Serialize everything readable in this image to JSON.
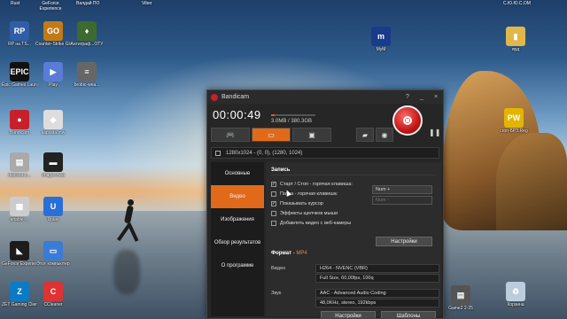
{
  "top_labels": [
    "Rust",
    "GeForce Experience",
    "Viber",
    "Валдай ПО",
    "С.Ю.Ю.С.ОМ"
  ],
  "desktop_left": [
    {
      "label": "RP на TS...",
      "color": "#2f5ea3",
      "glyph": "RP"
    },
    {
      "label": "Counter-Strike Global Offe...",
      "color": "#c27a18",
      "glyph": "GO"
    },
    {
      "label": "Антиграф...ОТУ",
      "color": "#3d6a2e",
      "glyph": "♦"
    },
    {
      "label": "Epic Games Launcher",
      "color": "#111",
      "glyph": "EPIC"
    },
    {
      "label": "Play",
      "color": "#5a7cd6",
      "glyph": "▶"
    },
    {
      "label": "brobic-wea...",
      "color": "#666",
      "glyph": "≡"
    },
    {
      "label": "Bandicam",
      "color": "#c7202a",
      "glyph": "●"
    },
    {
      "label": "kapusta.mw",
      "color": "#ddd",
      "glyph": "◆"
    },
    {
      "label": "dkdfx14.c...",
      "color": "#aaa",
      "glyph": "▤"
    },
    {
      "label": "Image.mwa",
      "color": "#222",
      "glyph": "▬"
    },
    {
      "label": "enable-...",
      "color": "#ccc",
      "glyph": "▦"
    },
    {
      "label": "Uplay",
      "color": "#2a6fd6",
      "glyph": "U"
    },
    {
      "label": "GeForce Experience",
      "color": "#1c1c1c",
      "glyph": "◣"
    },
    {
      "label": "Этот компьютер",
      "color": "#3a7bd5",
      "glyph": "▭"
    },
    {
      "label": "ZET Gaming Client",
      "color": "#0d7ac4",
      "glyph": "Z"
    },
    {
      "label": "CCleaner",
      "color": "#d33",
      "glyph": "C"
    }
  ],
  "desktop_right": [
    {
      "label": "MyM",
      "color": "#1a3b8c",
      "glyph": "m"
    },
    {
      "label": "ярд",
      "color": "#e0b84a",
      "glyph": "▮"
    },
    {
      "label": "cron-БРЗ.Reg",
      "color": "#e2b600",
      "glyph": "PW"
    },
    {
      "label": "Корзина",
      "color": "#bcd",
      "glyph": "♻"
    },
    {
      "label": "Game2 2-25",
      "color": "#555",
      "glyph": "▤"
    }
  ],
  "bandicam": {
    "title": "Bandicam",
    "help": "?",
    "minimize": "_",
    "close": "×",
    "timer": "00:00:49",
    "size_text": "3.0MB / 380.3GB",
    "size_progress": 0.08,
    "region_text": "1280x1024 - (0, 0), (1280, 1024)",
    "tabs": [
      "Основные",
      "Видео",
      "Изображения",
      "Обзор результатов",
      "О программе"
    ],
    "active_tab": "Видео",
    "record_section": "Запись",
    "options": [
      {
        "label": "Старт / Стоп - горячая клавиша:",
        "checked": true
      },
      {
        "label": "Пауза - горячая клавиша:",
        "checked": false
      },
      {
        "label": "Показывать курсор",
        "checked": true
      },
      {
        "label": "Эффекты щелчков мыши",
        "checked": false
      },
      {
        "label": "Добавлять видео с веб-камеры",
        "checked": false
      }
    ],
    "hotkey_start": "Num +",
    "hotkey_pause": "Num -",
    "settings_btn": "Настройки",
    "format_label": "Формат",
    "format_value": "MP4",
    "video_label": "Видео",
    "video_codec": "H264 - NVENC (VBR)",
    "video_quality": "Full Size, 60,00fps, 100q",
    "audio_label": "Звук",
    "audio_codec": "AAC - Advanced Audio Coding",
    "audio_quality": "48,0KHz, stereo, 192kbps",
    "bottom_btn1": "Настройки",
    "bottom_btn2": "Шаблоны"
  }
}
